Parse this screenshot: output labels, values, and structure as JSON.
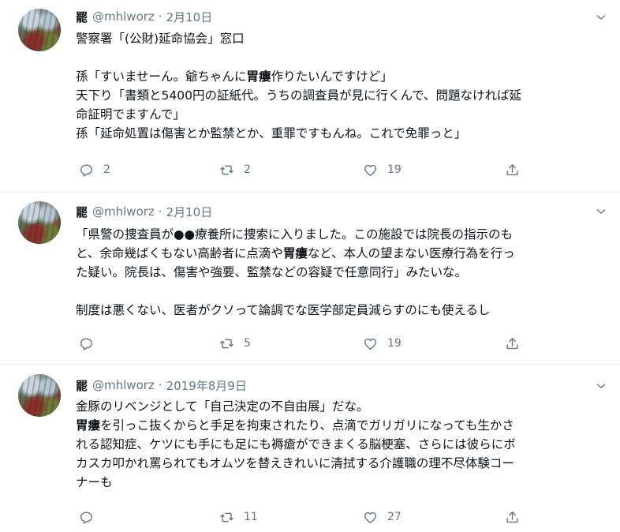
{
  "tweets": [
    {
      "name": "罷",
      "handle": "@mhlworz",
      "separator": "·",
      "time": "2月10日",
      "lines": [
        "警察署「(公財)延命協会」窓口",
        "",
        "孫「すいませーん。爺ちゃんに胃瘻作りたいんですけど」",
        "天下り「書類と5400円の証紙代。うちの調査員が見に行くんで、問題なければ延",
        "命証明でますんで」",
        "孫「延命処置は傷害とか監禁とか、重罪ですもんね。これで免罪っと」"
      ],
      "replies": "2",
      "retweets": "2",
      "likes": "19"
    },
    {
      "name": "罷",
      "handle": "@mhlworz",
      "separator": "·",
      "time": "2月10日",
      "lines": [
        "「県警の捜査員が●●療養所に捜索に入りました。この施設では院長の指示のも",
        "と、余命幾ばくもない高齢者に点滴や胃瘻など、本人の望まない医療行為を行っ",
        "た疑い。院長は、傷害や強要、監禁などの容疑で任意同行」みたいな。",
        "",
        "制度は悪くない、医者がクソって論調でな医学部定員減らすのにも使えるし"
      ],
      "replies": "",
      "retweets": "5",
      "likes": "19"
    },
    {
      "name": "罷",
      "handle": "@mhlworz",
      "separator": "·",
      "time": "2019年8月9日",
      "lines": [
        "金豚のリベンジとして「自己決定の不自由展」だな。",
        "胃瘻を引っこ抜くからと手足を拘束されたり、点滴でガリガリになっても生かさ",
        "れる認知症、ケツにも手にも足にも褥瘡ができまくる脳梗塞、さらには彼らにボ",
        "カスカ叩かれ罵られてもオムツを替えきれいに清拭する介護職の理不尽体験コー",
        "ナーも"
      ],
      "replies": "",
      "retweets": "11",
      "likes": "27"
    }
  ],
  "icons": {
    "reply": "reply-icon",
    "retweet": "retweet-icon",
    "like": "like-icon",
    "share": "share-icon",
    "more": "chevron-down-icon"
  },
  "colors": {
    "text": "#0f1419",
    "secondary": "#657786",
    "divider": "#e6ecf0"
  }
}
